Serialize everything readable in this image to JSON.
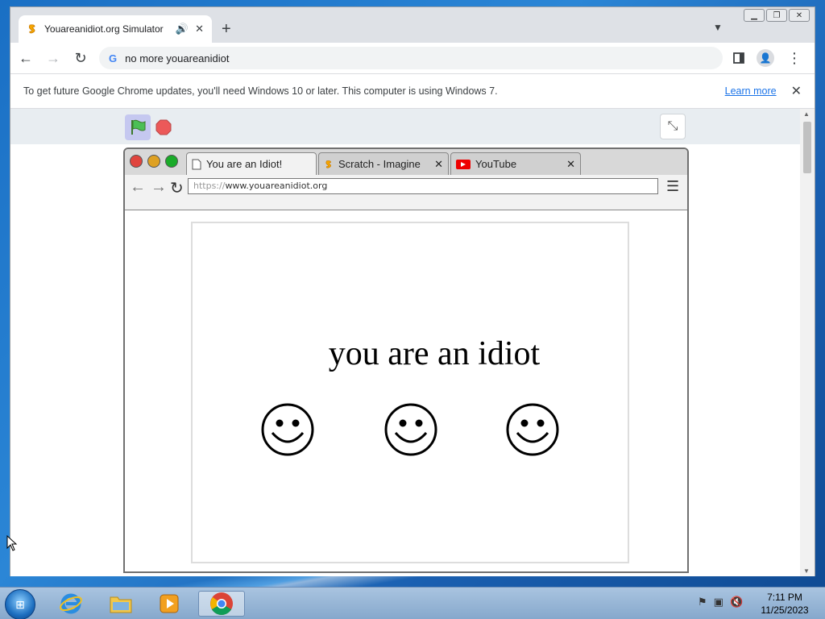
{
  "browser": {
    "tab": {
      "title": "Youareanidiot.org Simulator",
      "favicon": "scratch-icon",
      "audio_icon": "🔊",
      "close": "✕"
    },
    "newtab": "+",
    "tablist": "⌄",
    "omnibox": {
      "text": "no more youareanidiot",
      "search_icon": "G"
    },
    "infobar": {
      "message": "To get future Google Chrome updates, you'll need Windows 10 or later. This computer is using Windows 7.",
      "link": "Learn more",
      "close": "✕"
    }
  },
  "scratch": {
    "fullscreen_icon": "⤡"
  },
  "simulated_browser": {
    "tabs": [
      {
        "title": "You are an Idiot!",
        "icon": "page-icon"
      },
      {
        "title": "Scratch - Imagine",
        "icon": "scratch-icon"
      },
      {
        "title": "YouTube",
        "icon": "youtube-icon"
      }
    ],
    "url_protocol": "https://",
    "url_host": "www.youareanidiot.org",
    "page_text": "you are an idiot",
    "smileys": 3,
    "menu_icon": "☰"
  },
  "taskbar": {
    "time": "7:11 PM",
    "date": "11/25/2023"
  },
  "colors": {
    "chrome_bg": "#dee1e6",
    "link": "#1a73e8",
    "desktop": "#2b86d6"
  }
}
